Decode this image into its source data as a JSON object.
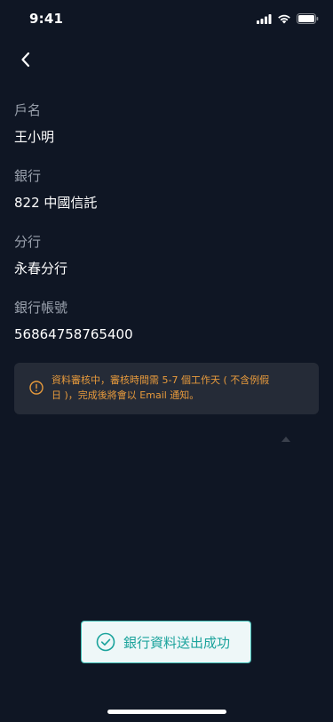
{
  "status_bar": {
    "time": "9:41"
  },
  "fields": [
    {
      "label": "戶名",
      "value": "王小明"
    },
    {
      "label": "銀行",
      "value": "822 中國信託"
    },
    {
      "label": "分行",
      "value": "永春分行"
    },
    {
      "label": "銀行帳號",
      "value": "56864758765400"
    }
  ],
  "notice": {
    "line1": "資料審核中，審核時間需 5-7 個工作天 ( 不含例假",
    "line2": "日 )，完成後將會以 Email 通知。"
  },
  "toast": {
    "text": "銀行資料送出成功"
  },
  "colors": {
    "background": "#0f1624",
    "notice_bg": "#252b37",
    "notice_text": "#e79a3c",
    "toast_bg": "#eef7f8",
    "toast_accent": "#1ba39c"
  },
  "icons": [
    "back-chevron-icon",
    "cellular-signal-icon",
    "wifi-icon",
    "battery-icon",
    "warning-circle-icon",
    "check-circle-icon"
  ]
}
